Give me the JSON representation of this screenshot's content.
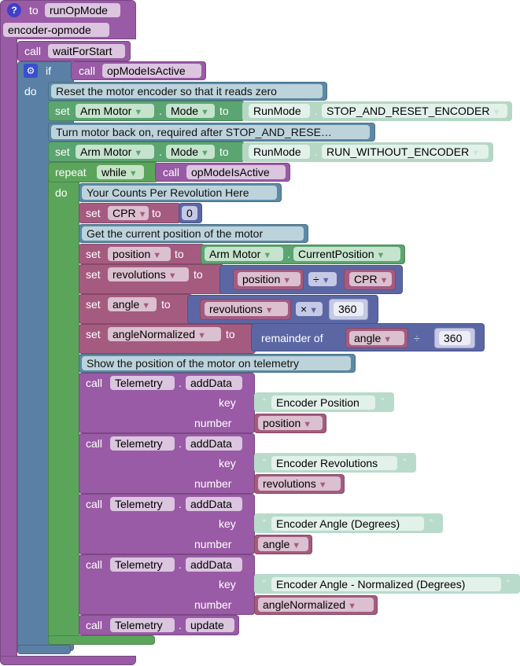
{
  "function_def": {
    "to_label": "to",
    "name": "runOpMode",
    "comment": "encoder-opmode",
    "help_icon": "question-icon"
  },
  "wait_block": {
    "call": "call",
    "name": "waitForStart"
  },
  "if_block": {
    "if_label": "if",
    "do_label": "do",
    "gear_icon": "gear-icon",
    "condition": {
      "call": "call",
      "name": "opModeIsActive"
    }
  },
  "comment1": "Reset the motor encoder so that it reads zero",
  "set_mode1": {
    "set": "set",
    "motor": "Arm Motor",
    "dot": ".",
    "prop": "Mode",
    "to": "to",
    "enum_type": "RunMode",
    "enum_value": "STOP_AND_RESET_ENCODER"
  },
  "comment2": "Turn motor back on, required after STOP_AND_RESE…",
  "set_mode2": {
    "set": "set",
    "motor": "Arm Motor",
    "dot": ".",
    "prop": "Mode",
    "to": "to",
    "enum_type": "RunMode",
    "enum_value": "RUN_WITHOUT_ENCODER"
  },
  "repeat_block": {
    "repeat": "repeat",
    "mode": "while",
    "do_label": "do",
    "condition": {
      "call": "call",
      "name": "opModeIsActive"
    }
  },
  "comment3": "Your Counts Per Revolution Here",
  "set_cpr": {
    "set": "set",
    "var": "CPR",
    "to": "to",
    "value": "0"
  },
  "comment4": "Get the current position of the motor",
  "set_position": {
    "set": "set",
    "var": "position",
    "to": "to",
    "motor": "Arm Motor",
    "dot": ".",
    "prop": "CurrentPosition"
  },
  "set_revolutions": {
    "set": "set",
    "var": "revolutions",
    "to": "to",
    "left": "position",
    "op": "÷",
    "right": "CPR"
  },
  "set_angle": {
    "set": "set",
    "var": "angle",
    "to": "to",
    "left": "revolutions",
    "op": "×",
    "right": "360"
  },
  "set_angle_norm": {
    "set": "set",
    "var": "angleNormalized",
    "to": "to",
    "func": "remainder of",
    "left": "angle",
    "op": "÷",
    "right": "360"
  },
  "comment5": "Show the position of the motor on telemetry",
  "telemetry": [
    {
      "call": "call",
      "obj": "Telemetry",
      "dot": ".",
      "method": "addData",
      "key_label": "key",
      "number_label": "number",
      "key": "Encoder Position",
      "number": "position"
    },
    {
      "call": "call",
      "obj": "Telemetry",
      "dot": ".",
      "method": "addData",
      "key_label": "key",
      "number_label": "number",
      "key": "Encoder Revolutions",
      "number": "revolutions"
    },
    {
      "call": "call",
      "obj": "Telemetry",
      "dot": ".",
      "method": "addData",
      "key_label": "key",
      "number_label": "number",
      "key": "Encoder Angle (Degrees)",
      "number": "angle"
    },
    {
      "call": "call",
      "obj": "Telemetry",
      "dot": ".",
      "method": "addData",
      "key_label": "key",
      "number_label": "number",
      "key": "Encoder Angle - Normalized (Degrees)",
      "number": "angleNormalized"
    }
  ],
  "update_block": {
    "call": "call",
    "obj": "Telemetry",
    "dot": ".",
    "method": "update"
  },
  "quote_open": "“",
  "quote_close": "”",
  "dropdown_glyph": "▼",
  "colors": {
    "procedure": "#995ba5",
    "logic": "#5b80a5",
    "loop": "#5ba55b",
    "variable": "#a55b80",
    "math": "#5b67a5",
    "motor": "#5ba570",
    "text": "#b8dbcc"
  }
}
